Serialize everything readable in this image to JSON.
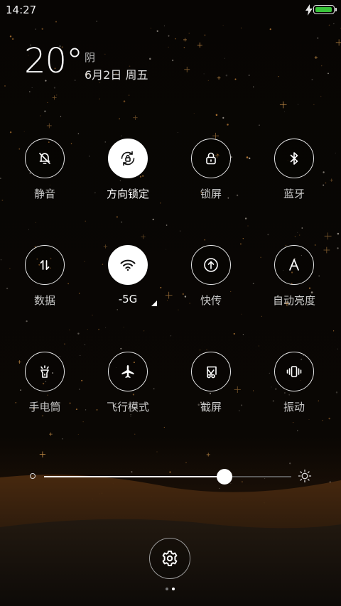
{
  "status_bar": {
    "time": "14:27",
    "battery_level": 1.0,
    "battery_color": "#39c43a",
    "charging": true
  },
  "weather": {
    "temperature": "20°",
    "condition": "阴",
    "date": "6月2日 周五"
  },
  "toggles": [
    {
      "label": "静音",
      "icon": "bell-off-icon",
      "active": false
    },
    {
      "label": "方向锁定",
      "icon": "rotation-lock-icon",
      "active": true
    },
    {
      "label": "锁屏",
      "icon": "lock-icon",
      "active": false
    },
    {
      "label": "蓝牙",
      "icon": "bluetooth-icon",
      "active": false
    },
    {
      "label": "数据",
      "icon": "mobile-data-icon",
      "active": false
    },
    {
      "label": "-5G",
      "icon": "wifi-icon",
      "active": true
    },
    {
      "label": "快传",
      "icon": "upload-icon",
      "active": false
    },
    {
      "label": "自动亮度",
      "icon": "auto-brightness-icon",
      "active": false
    },
    {
      "label": "手电筒",
      "icon": "flashlight-icon",
      "active": false
    },
    {
      "label": "飞行模式",
      "icon": "airplane-icon",
      "active": false
    },
    {
      "label": "截屏",
      "icon": "screenshot-icon",
      "active": false
    },
    {
      "label": "振动",
      "icon": "vibrate-icon",
      "active": false
    }
  ],
  "brightness": {
    "level": 0.73
  },
  "settings": {
    "icon": "gear-icon"
  },
  "pager": {
    "pages": 2,
    "current_page": 2
  },
  "colors": {
    "accent_active": "#ffffff",
    "wallpaper_glow": "#b35e17"
  }
}
